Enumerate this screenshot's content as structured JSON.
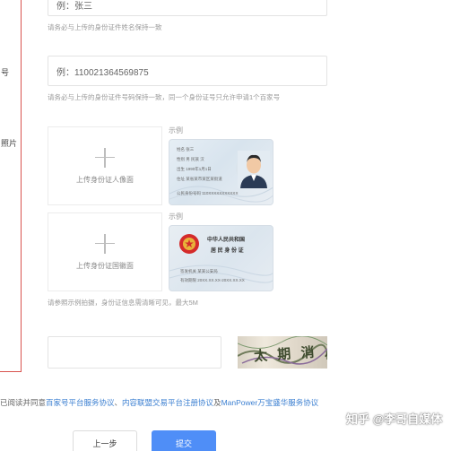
{
  "left_panel": {
    "label_1": "号",
    "label_2": "照片"
  },
  "name_field": {
    "placeholder": "例：张三",
    "hint": "请务必与上传的身份证件姓名保持一致"
  },
  "id_field": {
    "placeholder": "例：110021364569875",
    "hint": "请务必与上传的身份证件号码保持一致，同一个身份证号只允许申请1个百家号"
  },
  "uploads": {
    "front_label": "上传身份证人像面",
    "back_label": "上传身份证国徽面",
    "sample_label_1": "示例",
    "sample_label_2": "示例",
    "hint": "请参照示例拍摄，身份证信息需清晰可见，最大5M"
  },
  "card_front": {
    "name_line": "姓名 张三",
    "gender_line": "性别 男  民族 汉",
    "birth_line": "出生 1990年1月1日",
    "address_line": "住址 某省某市某区某街道",
    "id_line": "公民身份号码 110XXXXXXXXXXX"
  },
  "card_back": {
    "country": "中华人民共和国",
    "card_title": "居 民 身 份 证",
    "authority_line": "签发机关 某某公安局",
    "validity_line": "有效期限 20XX.XX.XX-20XX.XX.XX"
  },
  "captcha": {
    "text": "太 期 消 八"
  },
  "agreement": {
    "prefix": "已阅读并同意",
    "link1": "百家号平台服务协议",
    "sep1": "、",
    "link2": "内容联盟交易平台注册协议",
    "sep2": "及",
    "link3": "ManPower万宝盛华服务协议"
  },
  "buttons": {
    "prev": "上一步",
    "submit": "提交"
  },
  "watermark": {
    "text": "知乎 @李哥自媒体"
  },
  "colors": {
    "accent": "#4f8ef7",
    "link": "#3b7fd1",
    "panel_border": "#d9534f"
  }
}
